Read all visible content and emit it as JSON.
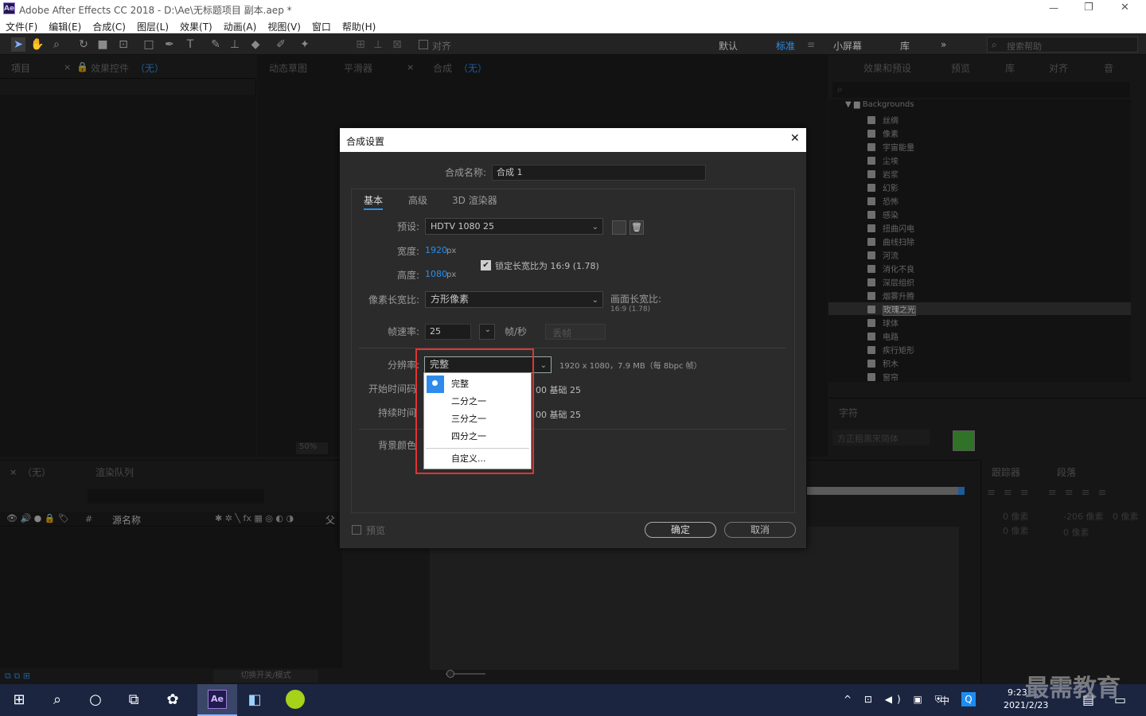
{
  "window": {
    "title": "Adobe After Effects CC 2018 - D:\\Ae\\无标题项目 副本.aep *",
    "app_badge": "Ae"
  },
  "window_controls": {
    "minimize": "—",
    "restore": "❐",
    "close": "✕"
  },
  "menu": [
    "文件(F)",
    "编辑(E)",
    "合成(C)",
    "图层(L)",
    "效果(T)",
    "动画(A)",
    "视图(V)",
    "窗口",
    "帮助(H)"
  ],
  "toolbar": {
    "align_label": "对齐"
  },
  "workspaces": {
    "default": "默认",
    "standard": "标准",
    "small_screen": "小屏幕",
    "library": "库",
    "search_placeholder": "搜索帮助"
  },
  "left_panel": {
    "project_tab": "项目",
    "effects_tab": "效果控件",
    "effects_none": "（无）"
  },
  "center_panel": {
    "tab1": "动态草图",
    "tab2": "平滑器",
    "comp_tab": "合成",
    "comp_none": "（无）",
    "zoom": "50%"
  },
  "right_panel": {
    "tabs": [
      "效果和预设",
      "预览",
      "库",
      "对齐",
      "音"
    ],
    "folder": "Backgrounds",
    "items": [
      "丝绸",
      "像素",
      "宇宙能量",
      "尘埃",
      "岩浆",
      "幻影",
      "恐怖",
      "感染",
      "扭曲闪电",
      "曲线扫除",
      "河流",
      "消化不良",
      "深层组织",
      "烟雾升腾",
      "玫瑰之光",
      "球体",
      "电路",
      "疾行矩形",
      "积木",
      "窗帘"
    ],
    "selected_index": 14
  },
  "character_panel": {
    "tab": "字符",
    "font": "方正粗黑宋简体",
    "fill_color": "#4caf3f"
  },
  "paragraph_panel": {
    "tracker_tab": "跟踪器",
    "para_tab": "段落",
    "indent1": "0 像素",
    "indent2": "-206 像素",
    "indent3": "0 像素",
    "indent4": "0 像素",
    "indent5": "0 像素"
  },
  "timeline": {
    "tab": "（无）",
    "render_queue": "渲染队列",
    "source_name": "源名称",
    "parent_prefix": "父",
    "hash": "#",
    "toggle_modes": "切换开关/模式"
  },
  "dialog": {
    "title": "合成设置",
    "close": "✕",
    "comp_name_label": "合成名称:",
    "comp_name_value": "合成 1",
    "tabs": [
      "基本",
      "高级",
      "3D 渲染器"
    ],
    "preset_label": "预设:",
    "preset_value": "HDTV 1080 25",
    "width_label": "宽度:",
    "width_value": "1920",
    "height_label": "高度:",
    "height_value": "1080",
    "px": "px",
    "lock_aspect": "锁定长宽比为 16:9 (1.78)",
    "pixel_aspect_label": "像素长宽比:",
    "pixel_aspect_value": "方形像素",
    "frame_aspect_label": "画面长宽比:",
    "frame_aspect_value": "16:9 (1.78)",
    "fps_label": "帧速率:",
    "fps_value": "25",
    "fps_unit": "帧/秒",
    "drop_frame": "丢帧",
    "resolution_label": "分辨率:",
    "resolution_value": "完整",
    "resolution_info": "1920 x 1080，7.9 MB（每 8bpc 帧）",
    "start_tc_label": "开始时间码",
    "start_tc_suffix": "00  基础 25",
    "duration_label": "持续时间",
    "duration_suffix": "00  基础 25",
    "bg_color_label": "背景颜色",
    "preview_label": "预览",
    "ok": "确定",
    "cancel": "取消"
  },
  "resolution_dropdown": {
    "items": [
      "完整",
      "二分之一",
      "三分之一",
      "四分之一",
      "自定义..."
    ],
    "selected_index": 0
  },
  "taskbar": {
    "time": "9:23",
    "date": "2021/2/23",
    "ime": "中",
    "ae_label": "Ae"
  },
  "watermark": "最需教育"
}
